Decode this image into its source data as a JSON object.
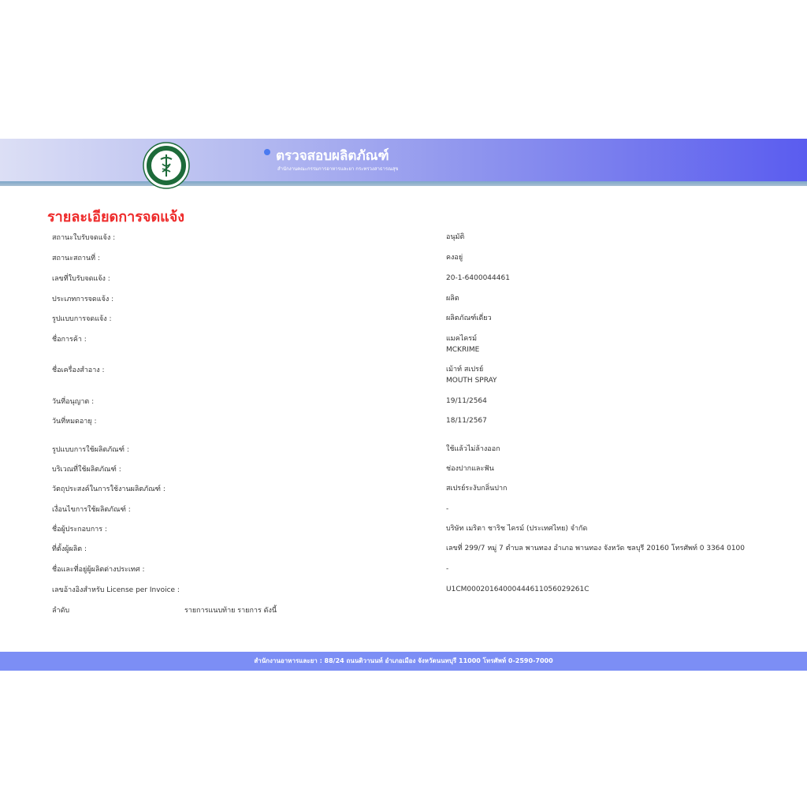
{
  "header": {
    "title": "ตรวจสอบผลิตภัณฑ์",
    "subtitle": "สำนักงานคณะกรรมการอาหารและยา กระทรวงสาธารณสุข",
    "seal_text": "กระทรวงสาธารณสุข",
    "seal_text_bottom": "MINISTRY OF PUBLIC HEALTH"
  },
  "page_title": "รายละเอียดการจดแจ้ง",
  "details": [
    {
      "label": "สถานะใบรับจดแจ้ง :",
      "value": "อนุมัติ"
    },
    {
      "label": "สถานะสถานที่ :",
      "value": "คงอยู่"
    },
    {
      "label": "เลขที่ใบรับจดแจ้ง :",
      "value": "20-1-6400044461"
    },
    {
      "label": "ประเภทการจดแจ้ง :",
      "value": "ผลิต"
    },
    {
      "label": "รูปแบบการจดแจ้ง :",
      "value": "ผลิตภัณฑ์เดี่ยว"
    },
    {
      "label": "ชื่อการค้า :",
      "value": "แมคไครม์",
      "value2": "MCKRIME"
    },
    {
      "label": "ชื่อเครื่องสำอาง :",
      "value": "เม้าท์ สเปรย์",
      "value2": "MOUTH SPRAY"
    },
    {
      "label": "วันที่อนุญาต :",
      "value": "19/11/2564"
    },
    {
      "label": "วันที่หมดอายุ :",
      "value": "18/11/2567"
    },
    {
      "label": "รูปแบบการใช้ผลิตภัณฑ์ :",
      "value": "ใช้แล้วไม่ล้างออก"
    },
    {
      "label": "บริเวณที่ใช้ผลิตภัณฑ์ :",
      "value": "ช่องปากและฟัน"
    },
    {
      "label": "วัตถุประสงค์ในการใช้งานผลิตภัณฑ์ :",
      "value": "สเปรย์ระงับกลิ่นปาก"
    },
    {
      "label": "เงื่อนไขการใช้ผลิตภัณฑ์ :",
      "value": "-"
    },
    {
      "label": "ชื่อผู้ประกอบการ :",
      "value": "บริษัท เมริตา ชาริช ไครม์ (ประเทศไทย) จำกัด"
    },
    {
      "label": "ที่ตั้งผู้ผลิต :",
      "value": "เลขที่ 299/7 หมู่ 7 ตำบล พานทอง อำเภอ พานทอง จังหวัด ชลบุรี 20160 โทรศัพท์ 0 3364 0100"
    },
    {
      "label": "ชื่อและที่อยู่ผู้ผลิตต่างประเทศ :",
      "value": "-"
    },
    {
      "label": "เลขอ้างอิงสำหรับ License per Invoice :",
      "value": "U1CM000201640004446110560292​61C"
    }
  ],
  "order_row": {
    "col1": "ลำดับ",
    "col2": "รายการแนบท้าย รายการ ดังนี้"
  },
  "footer": {
    "text": "สำนักงานอาหารและยา : 88/24 ถนนติวานนท์ อำเภอเมือง จังหวัดนนทบุรี 11000 โทรศัพท์ 0-2590-7000"
  }
}
